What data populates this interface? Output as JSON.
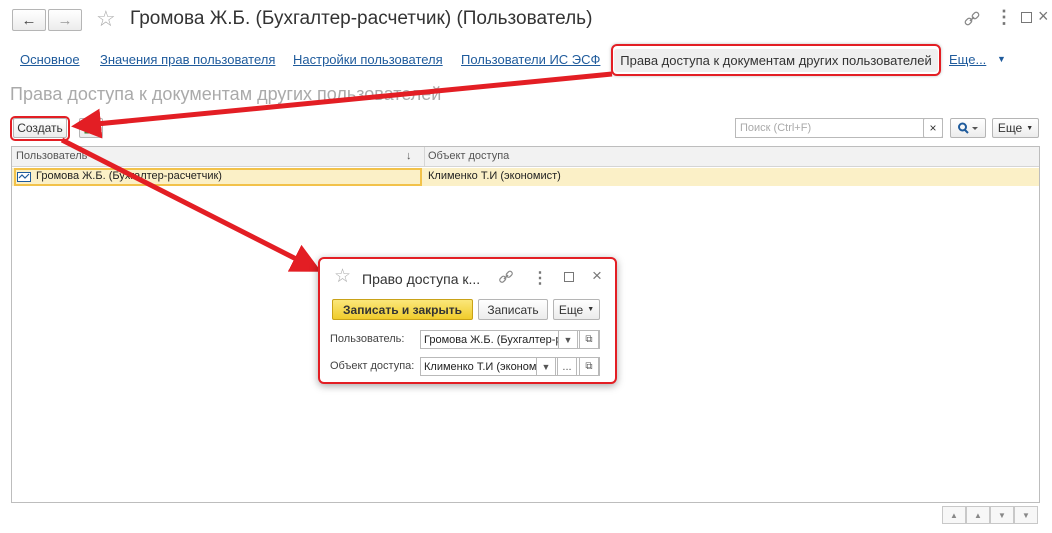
{
  "header": {
    "back_icon": "arrow-left-icon",
    "forward_icon": "arrow-right-icon",
    "star_icon": "star-outline-icon",
    "title": "Громова Ж.Б. (Бухгалтер-расчетчик) (Пользователь)",
    "link_icon": "link-icon",
    "more_icon": "vertical-dots-icon",
    "maximize_icon": "maximize-icon",
    "close_icon": "close-icon"
  },
  "tabs": [
    {
      "label": "Основное"
    },
    {
      "label": "Значения прав пользователя"
    },
    {
      "label": "Настройки пользователя"
    },
    {
      "label": "Пользователи ИС ЭСФ"
    },
    {
      "label": "Права доступа к документам других пользователей"
    },
    {
      "label": "Еще..."
    }
  ],
  "section_title": "Права доступа к документам других пользователей",
  "toolbar": {
    "create_label": "Создать",
    "search_placeholder": "Поиск (Ctrl+F)",
    "search_clear": "×",
    "more_label": "Еще"
  },
  "table": {
    "columns": [
      "Пользователь",
      "Объект доступа"
    ],
    "sort_indicator": "↓",
    "rows": [
      {
        "user": "Громова Ж.Б. (Бухгалтер-расчетчик)",
        "object": "Клименко Т.И (экономист)"
      }
    ]
  },
  "dialog": {
    "title": "Право доступа к...",
    "save_close_label": "Записать и закрыть",
    "save_label": "Записать",
    "more_label": "Еще",
    "user_label": "Пользователь:",
    "user_value": "Громова Ж.Б. (Бухгалтер-р",
    "object_label": "Объект доступа:",
    "object_value": "Клименко Т.И (эконом",
    "ellipsis": "..."
  },
  "colors": {
    "accent_red": "#e31e24",
    "link_blue": "#1f5b9c",
    "selected_row": "#fbf0c7",
    "primary_button": "#f5d94a"
  }
}
